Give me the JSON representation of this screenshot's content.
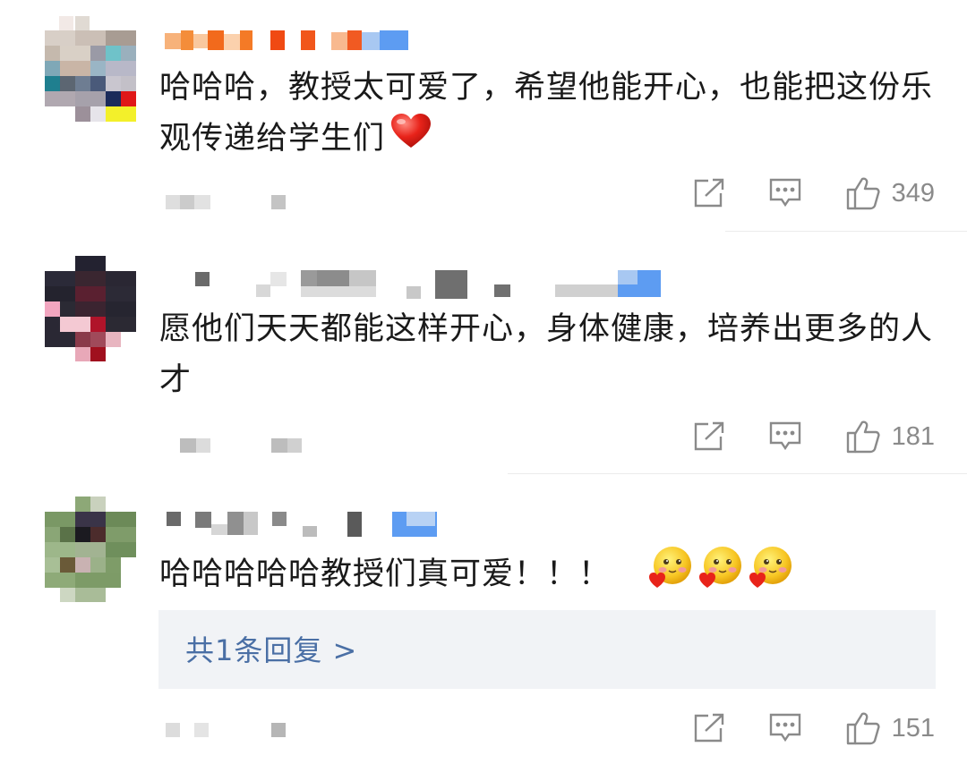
{
  "comments": [
    {
      "text": "哈哈哈，教授太可爱了，希望他能开心，也能把这份乐观传递给学生们",
      "likes": "349",
      "trailing_icon": "red-heart-emoji"
    },
    {
      "text": "愿他们天天都能这样开心，身体健康，培养出更多的人才",
      "likes": "181"
    },
    {
      "text": "哈哈哈哈哈教授们真可爱！！！",
      "likes": "151",
      "trailing_icons": [
        "blushing-heart-emoji",
        "blushing-heart-emoji",
        "blushing-heart-emoji"
      ],
      "reply_label": "共1条回复 >"
    }
  ],
  "icons": {
    "share": "share-icon",
    "comment": "comment-icon",
    "like": "thumbs-up-icon"
  },
  "colors": {
    "reply_link": "#4a6fa5",
    "icon_gray": "#8a8a8a",
    "reply_bg": "#f1f3f6"
  }
}
